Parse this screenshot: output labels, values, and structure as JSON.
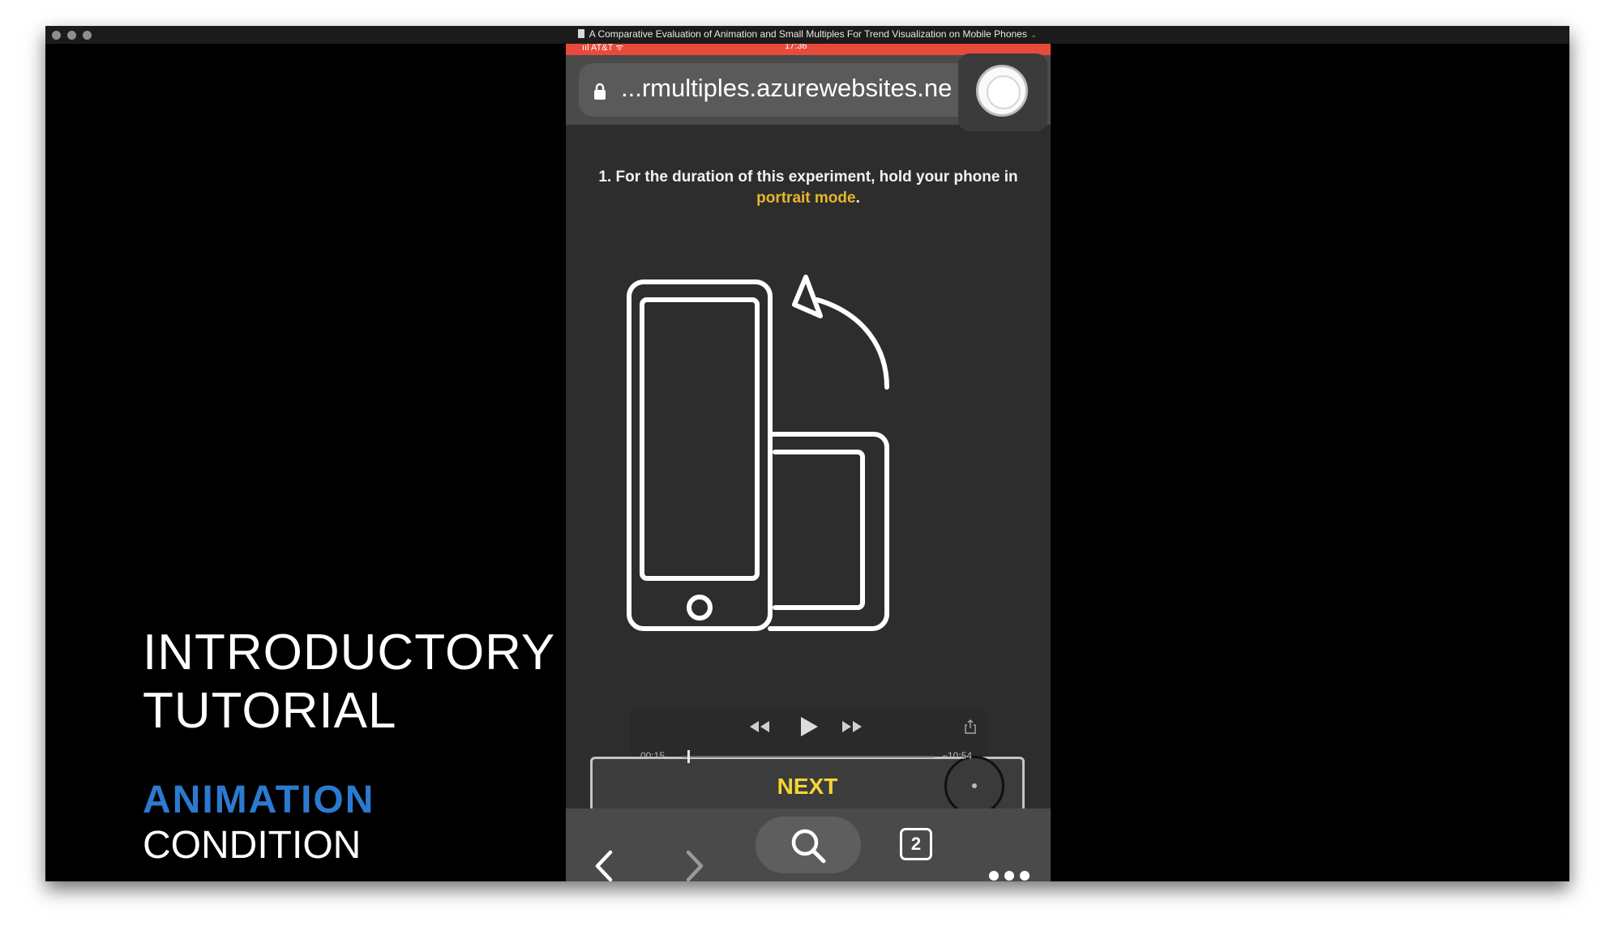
{
  "window": {
    "title": "A Comparative Evaluation of Animation and Small Multiples For Trend Visualization on Mobile Phones",
    "title_chevron": "⌄"
  },
  "slide": {
    "heading_line1": "INTRODUCTORY",
    "heading_line2": "TUTORIAL",
    "condition_name": "ANIMATION",
    "condition_word": "CONDITION",
    "condition_color": "#2b7ad0"
  },
  "phone": {
    "status": {
      "carrier": "ııl AT&T ᯤ",
      "time": "17:36"
    },
    "address_bar": {
      "url": "...rmultiples.azurewebsites.ne"
    },
    "instruction": {
      "prefix": "1. For the duration of this experiment, hold your phone in",
      "highlight": "portrait mode",
      "suffix": ".",
      "highlight_color": "#e6b62c"
    },
    "next_button_label": "NEXT",
    "player": {
      "elapsed": "00:15",
      "remaining": "−10:54",
      "progress": 0.02
    },
    "toolbar": {
      "tab_count": "2"
    }
  },
  "icons": {
    "lock": "lock-icon",
    "record": "record-icon",
    "rewind": "rewind-icon",
    "play": "play-icon",
    "fast_forward": "fast-forward-icon",
    "share": "share-icon",
    "back": "chevron-left-icon",
    "forward": "chevron-right-icon",
    "search": "search-icon",
    "tabs": "tabs-icon",
    "more": "more-icon",
    "rotate": "rotate-phone-icon"
  }
}
